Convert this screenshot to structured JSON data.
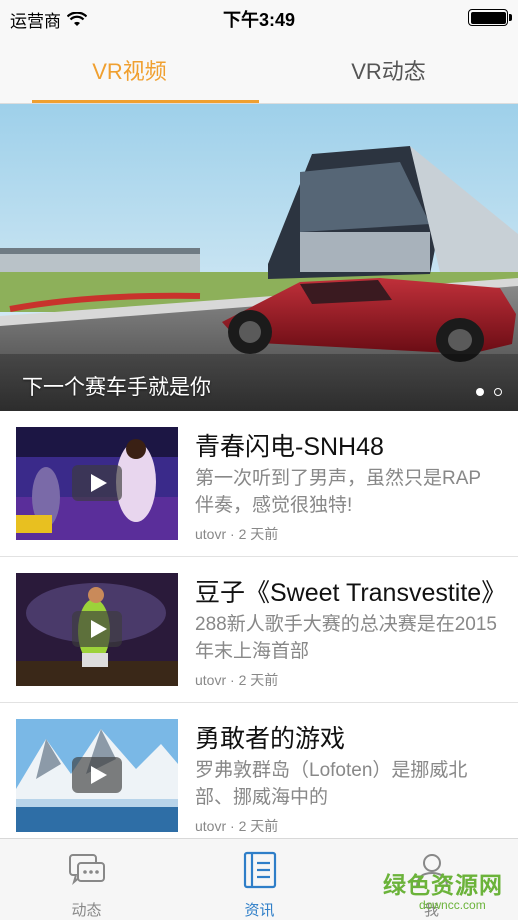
{
  "status_bar": {
    "carrier": "运营商",
    "time": "下午3:49"
  },
  "top_tabs": [
    {
      "label": "VR视频",
      "active": true
    },
    {
      "label": "VR动态",
      "active": false
    }
  ],
  "banner": {
    "caption": "下一个赛车手就是你",
    "page_count": 2,
    "current_page": 1
  },
  "feed": [
    {
      "title": "青春闪电-SNH48",
      "description": "第一次听到了男声，虽然只是RAP伴奏，感觉很独特!",
      "meta": "utovr · 2 天前"
    },
    {
      "title": "豆子《Sweet Transvestite》",
      "description": "288新人歌手大赛的总决赛是在2015年末上海首部",
      "meta": "utovr · 2 天前"
    },
    {
      "title": "勇敢者的游戏",
      "description": "罗弗敦群岛（Lofoten）是挪威北部、挪威海中的",
      "meta": "utovr · 2 天前"
    }
  ],
  "tab_bar": [
    {
      "label": "动态",
      "icon": "chat-bubbles-icon",
      "active": false
    },
    {
      "label": "资讯",
      "icon": "news-list-icon",
      "active": true
    },
    {
      "label": "我",
      "icon": "person-icon",
      "active": false
    }
  ],
  "watermark": {
    "main": "绿色资源网",
    "sub": "downcc.com"
  },
  "colors": {
    "accent": "#f0a030",
    "tab_active": "#2e7ec8",
    "watermark": "#6bb33a"
  }
}
